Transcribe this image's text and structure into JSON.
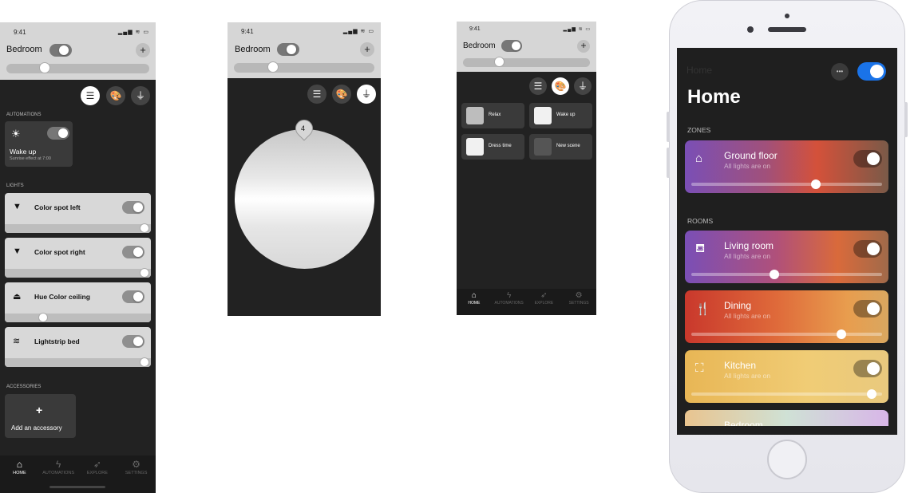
{
  "status_time": "9:41",
  "status_icons": "▂▄▆ ≋ ▭",
  "room_name": "Bedroom",
  "plus_glyph": "+",
  "view_icons": {
    "list": "☰",
    "palette": "🎨",
    "plug": "⏚"
  },
  "screen1": {
    "automations_label": "AUTOMATIONS",
    "automation": {
      "icon": "sunrise-icon",
      "glyph": "☀",
      "title": "Wake up",
      "subtitle": "Sunrise effect at 7:00"
    },
    "lights_label": "LIGHTS",
    "lights": [
      {
        "name": "Color spot left",
        "icon": "spotlight-icon",
        "glyph": "▼",
        "brightness": 1.0
      },
      {
        "name": "Color spot right",
        "icon": "spotlight-icon",
        "glyph": "▼",
        "brightness": 1.0
      },
      {
        "name": "Hue Color ceiling",
        "icon": "ceiling-light-icon",
        "glyph": "⏏",
        "brightness": 0.25
      },
      {
        "name": "Lightstrip bed",
        "icon": "lightstrip-icon",
        "glyph": "≋",
        "brightness": 1.0
      }
    ],
    "accessories_label": "ACCESSORIES",
    "add_accessory": "Add an accessory",
    "room_brightness": 0.25
  },
  "screen2": {
    "marker_value": "4",
    "room_brightness": 0.25
  },
  "screen3": {
    "room_brightness": 0.25,
    "scenes": [
      {
        "name": "Relax",
        "swatch": "#bdbdbd"
      },
      {
        "name": "Wake up",
        "swatch": "#f1f1f1"
      },
      {
        "name": "Dress time",
        "swatch": "#f1f1f1"
      },
      {
        "name": "New scene",
        "swatch": "#555555"
      }
    ]
  },
  "tabs": [
    {
      "label": "HOME",
      "icon": "home-icon",
      "glyph": "⌂"
    },
    {
      "label": "AUTOMATIONS",
      "icon": "lightning-icon",
      "glyph": "ϟ"
    },
    {
      "label": "EXPLORE",
      "icon": "rocket-icon",
      "glyph": "➶"
    },
    {
      "label": "SETTINGS",
      "icon": "gear-icon",
      "glyph": "⚙"
    }
  ],
  "iphone": {
    "nav_title": "Home",
    "more_glyph": "•••",
    "page_title": "Home",
    "zones_label": "ZONES",
    "rooms_label": "ROOMS",
    "zone": {
      "name": "Ground floor",
      "status": "All lights are on",
      "icon": "house-icon",
      "glyph": "⌂",
      "brightness": 0.66,
      "gradient": "linear-gradient(90deg,#7a4fb6 0%,#a1507a 40%,#d4513a 65%,#7a5a48 100%)"
    },
    "rooms": [
      {
        "name": "Living room",
        "status": "All lights are on",
        "icon": "sofa-icon",
        "glyph": "⛾",
        "brightness": 0.43,
        "gradient": "linear-gradient(90deg,#7a4fb6 0%,#b0507a 45%,#d96a3b 75%,#a06a4a 100%)"
      },
      {
        "name": "Dining",
        "status": "All lights are on",
        "icon": "cutlery-icon",
        "glyph": "🍴",
        "brightness": 0.8,
        "gradient": "linear-gradient(90deg,#c9382c 0%,#df6a3a 45%,#e89d4e 80%,#d9a760 100%)"
      },
      {
        "name": "Kitchen",
        "status": "All lights are on",
        "icon": "pot-icon",
        "glyph": "⛶",
        "brightness": 0.97,
        "gradient": "linear-gradient(90deg,#e8b655 0%,#f0cc75 60%,#e9c97e 100%)"
      },
      {
        "name": "Bedroom",
        "status": "",
        "icon": "bed-icon",
        "glyph": "",
        "brightness": 0,
        "gradient": "linear-gradient(90deg,#e9c48f,#cfe1d5,#d8b6e8)"
      }
    ]
  },
  "colors": {
    "bg_dark": "#222222",
    "header": "#d6d6d6",
    "accent_blue": "#1a73e8"
  }
}
